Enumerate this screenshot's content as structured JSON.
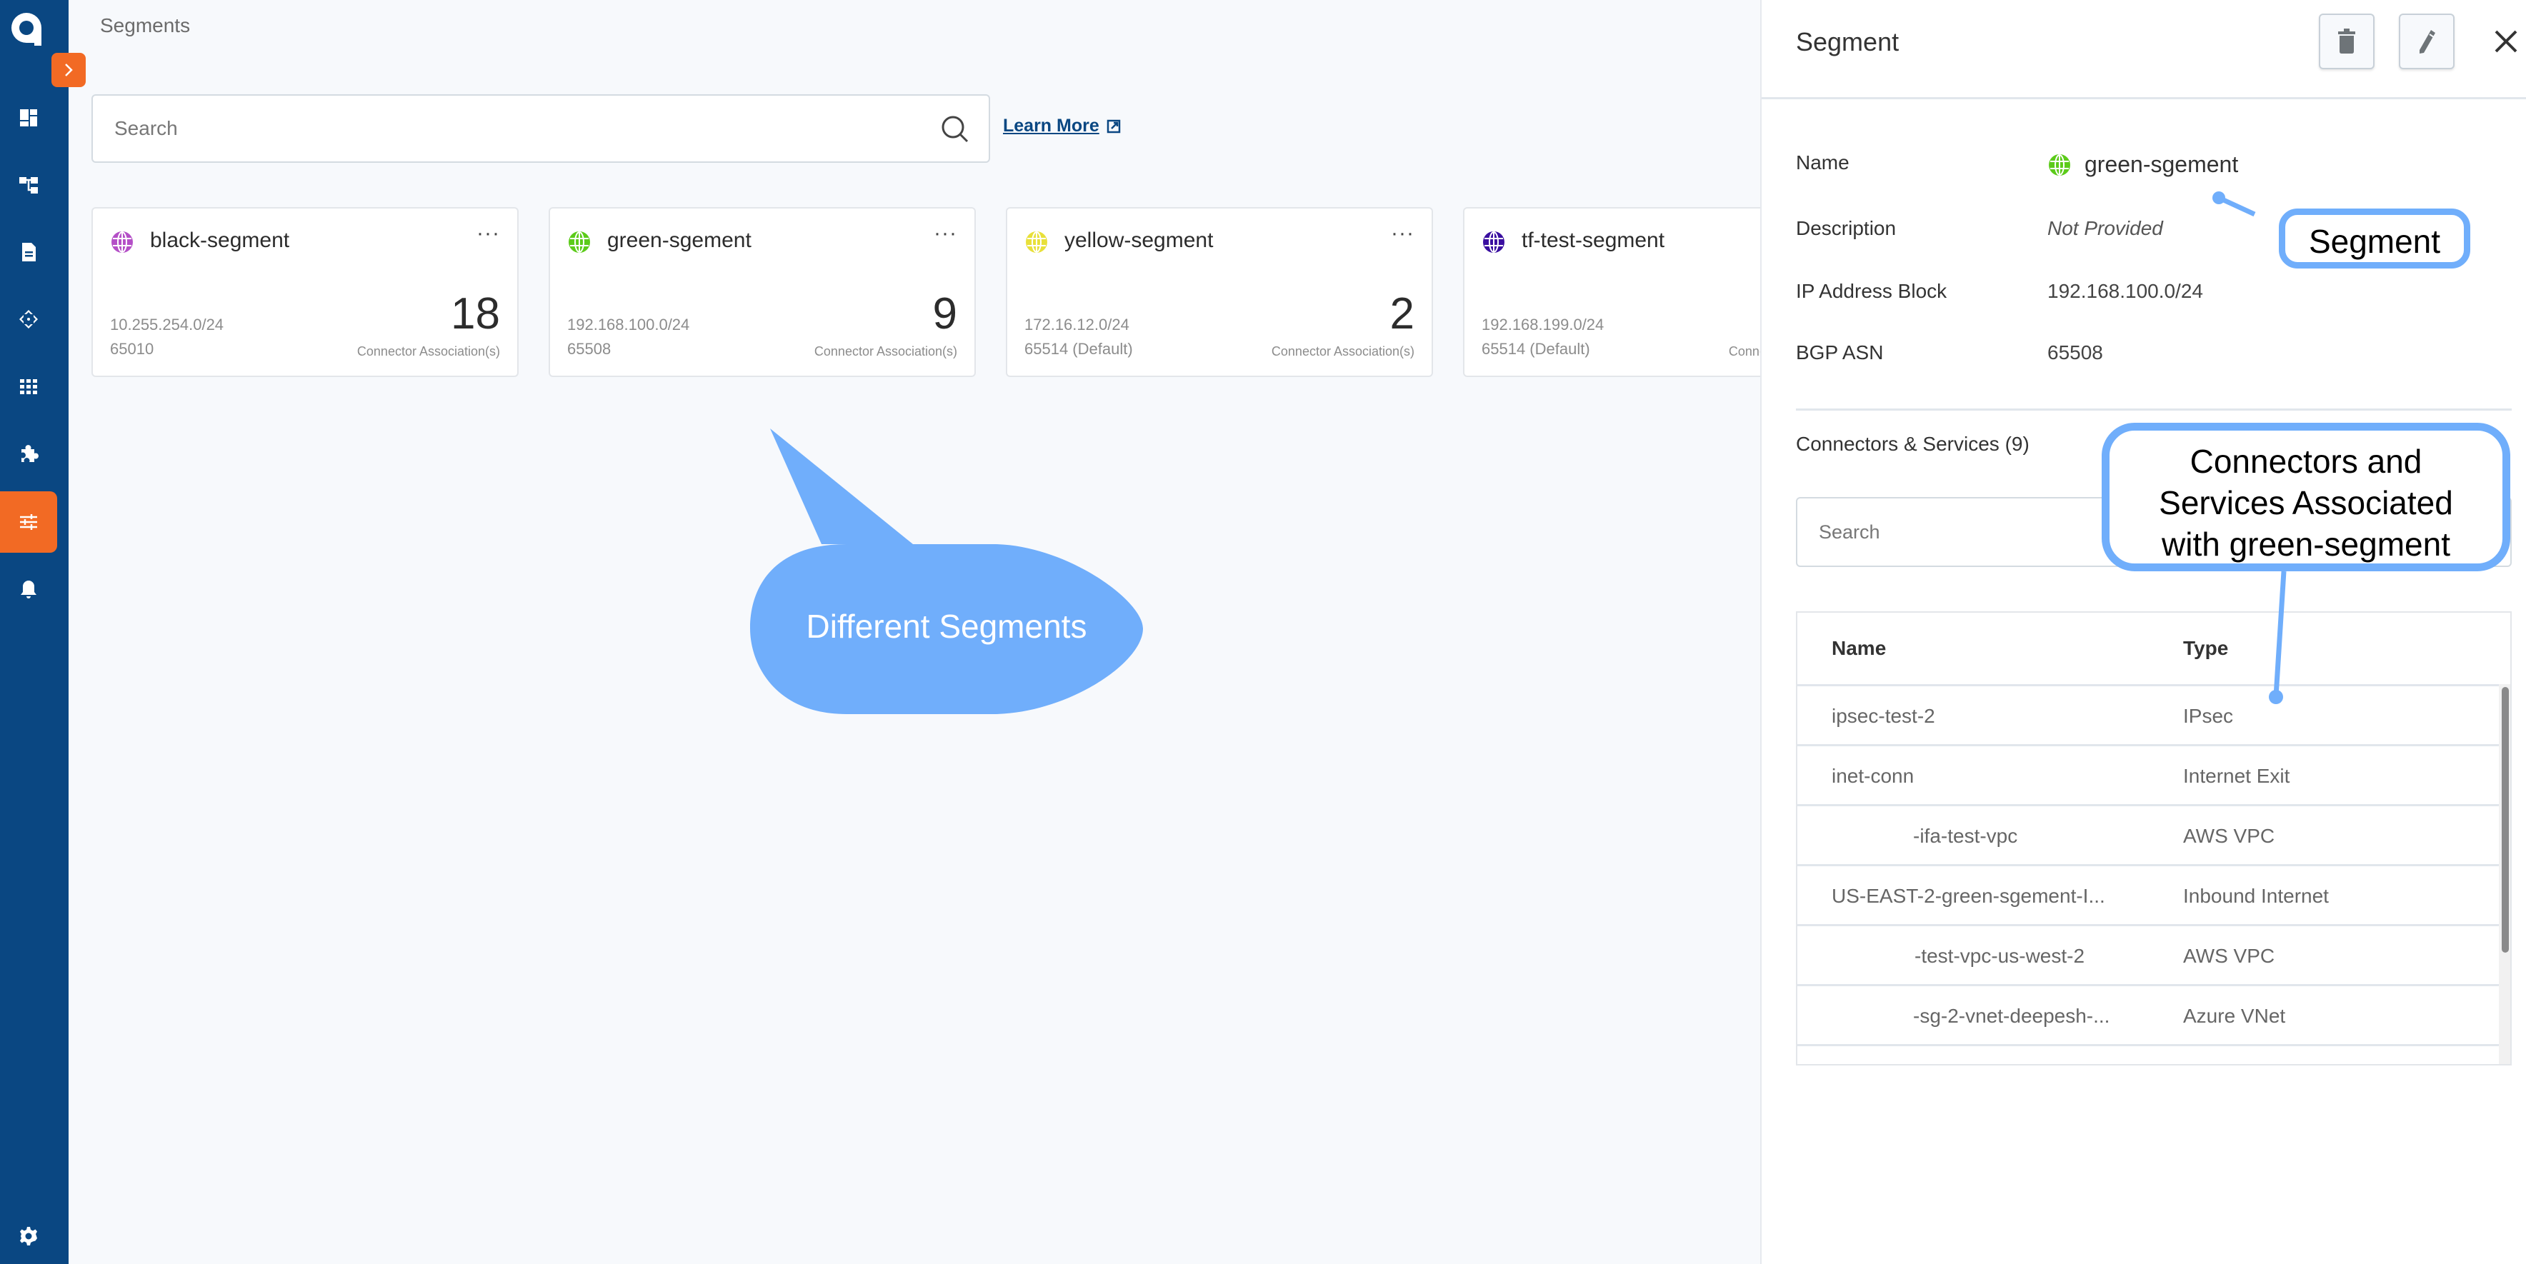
{
  "sidebar": {
    "logo": "aviatrix-logo",
    "collapse_icon": "chevron-right-icon",
    "items": [
      {
        "name": "dashboard",
        "icon": "dashboard-icon",
        "active": false
      },
      {
        "name": "topology",
        "icon": "topology-icon",
        "active": false
      },
      {
        "name": "reports",
        "icon": "document-icon",
        "active": false
      },
      {
        "name": "networking",
        "icon": "arrows-icon",
        "active": false
      },
      {
        "name": "apps",
        "icon": "grid-icon",
        "active": false
      },
      {
        "name": "extensions",
        "icon": "puzzle-icon",
        "active": false
      },
      {
        "name": "segments",
        "icon": "sliders-icon",
        "active": true
      },
      {
        "name": "notifications",
        "icon": "bell-icon",
        "active": false
      }
    ],
    "settings_icon": "gear-icon"
  },
  "main": {
    "title": "Segments",
    "search": {
      "placeholder": "Search",
      "value": ""
    },
    "learn_more": "Learn More",
    "cards": [
      {
        "name": "black-segment",
        "color": "#b44fc7",
        "ip": "10.255.254.0/24",
        "asn": "65010",
        "count": "18",
        "count_label": "Connector Association(s)",
        "more": "···"
      },
      {
        "name": "green-sgement",
        "color": "#5ccb1a",
        "ip": "192.168.100.0/24",
        "asn": "65508",
        "count": "9",
        "count_label": "Connector Association(s)",
        "more": "···"
      },
      {
        "name": "yellow-segment",
        "color": "#e8e03a",
        "ip": "172.16.12.0/24",
        "asn": "65514 (Default)",
        "count": "2",
        "count_label": "Connector Association(s)",
        "more": "···"
      },
      {
        "name": "tf-test-segment",
        "color": "#3a0fa0",
        "ip": "192.168.199.0/24",
        "asn": "65514 (Default)",
        "count": "",
        "count_label": "Connector Association(s)",
        "more": "···"
      }
    ]
  },
  "annotations": {
    "different_segments": "Different Segments",
    "segment": "Segment",
    "connectors": [
      "Connectors and",
      "Services Associated",
      "with green-segment"
    ],
    "color": "#70aefb"
  },
  "panel": {
    "title": "Segment",
    "delete_icon": "trash-icon",
    "edit_icon": "pencil-icon",
    "close_icon": "close-icon",
    "fields": {
      "name_label": "Name",
      "name_value": "green-sgement",
      "name_color": "#5ccb1a",
      "description_label": "Description",
      "description_value": "Not Provided",
      "ip_label": "IP Address Block",
      "ip_value": "192.168.100.0/24",
      "asn_label": "BGP ASN",
      "asn_value": "65508"
    },
    "connectors_title": "Connectors & Services (9)",
    "search": {
      "placeholder": "Search",
      "value": ""
    },
    "table": {
      "headers": [
        "Name",
        "Type"
      ],
      "rows": [
        {
          "name": "ipsec-test-2",
          "type": "IPsec",
          "indent": false
        },
        {
          "name": "inet-conn",
          "type": "Internet Exit",
          "indent": false
        },
        {
          "name": "-ifa-test-vpc",
          "type": "AWS VPC",
          "indent": true
        },
        {
          "name": "US-EAST-2-green-sgement-I...",
          "type": "Inbound Internet",
          "indent": false
        },
        {
          "name": "-test-vpc-us-west-2",
          "type": "AWS VPC",
          "indent": true
        },
        {
          "name": "-sg-2-vnet-deepesh-...",
          "type": "Azure VNet",
          "indent": true
        }
      ]
    }
  }
}
